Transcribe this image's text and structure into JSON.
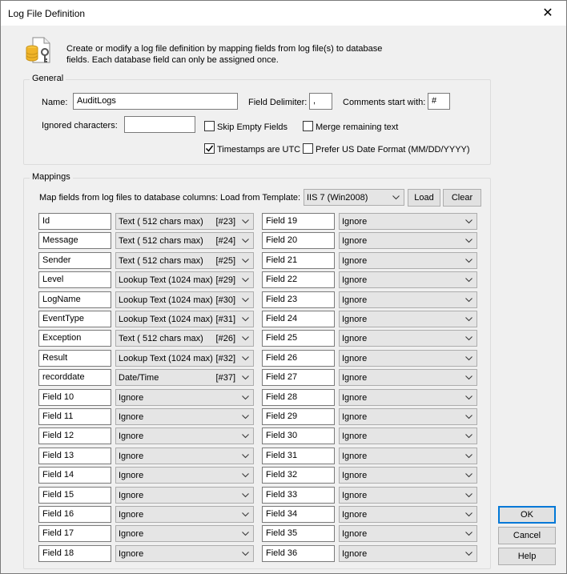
{
  "window": {
    "title": "Log File Definition",
    "close_glyph": "✕"
  },
  "intro": {
    "icon": "database-key-icon",
    "text": "Create or modify a log file definition by mapping fields from log file(s) to database fields. Each database field can only be assigned once."
  },
  "general": {
    "group_label": "General",
    "name_label": "Name:",
    "name_value": "AuditLogs",
    "delimiter_label": "Field Delimiter:",
    "delimiter_value": ",",
    "comments_label": "Comments start with:",
    "comments_value": "#",
    "ignored_label": "Ignored characters:",
    "ignored_value": "",
    "skip_empty": {
      "label": "Skip Empty Fields",
      "checked": false
    },
    "merge_remaining": {
      "label": "Merge remaining text",
      "checked": false
    },
    "timestamps_utc": {
      "label": "Timestamps are UTC",
      "checked": true
    },
    "us_date": {
      "label": "Prefer US Date Format (MM/DD/YYYY)",
      "checked": false
    }
  },
  "mappings": {
    "group_label": "Mappings",
    "map_label": "Map fields from log files to database columns:",
    "template_label": "Load from Template:",
    "template_value": "IIS 7 (Win2008)",
    "load_button": "Load",
    "clear_button": "Clear",
    "left": [
      {
        "field": "Id",
        "type": "Text (  512 chars max)",
        "tag": "[#23]"
      },
      {
        "field": "Message",
        "type": "Text (  512 chars max)",
        "tag": "[#24]"
      },
      {
        "field": "Sender",
        "type": "Text (  512 chars max)",
        "tag": "[#25]"
      },
      {
        "field": "Level",
        "type": "Lookup Text (1024 max)",
        "tag": "[#29]"
      },
      {
        "field": "LogName",
        "type": "Lookup Text (1024 max)",
        "tag": "[#30]"
      },
      {
        "field": "EventType",
        "type": "Lookup Text (1024 max)",
        "tag": "[#31]"
      },
      {
        "field": "Exception",
        "type": "Text (  512 chars max)",
        "tag": "[#26]"
      },
      {
        "field": "Result",
        "type": "Lookup Text (1024 max)",
        "tag": "[#32]"
      },
      {
        "field": "recorddate",
        "type": "Date/Time",
        "tag": "[#37]"
      },
      {
        "field": "Field 10",
        "type": "Ignore",
        "tag": ""
      },
      {
        "field": "Field 11",
        "type": "Ignore",
        "tag": ""
      },
      {
        "field": "Field 12",
        "type": "Ignore",
        "tag": ""
      },
      {
        "field": "Field 13",
        "type": "Ignore",
        "tag": ""
      },
      {
        "field": "Field 14",
        "type": "Ignore",
        "tag": ""
      },
      {
        "field": "Field 15",
        "type": "Ignore",
        "tag": ""
      },
      {
        "field": "Field 16",
        "type": "Ignore",
        "tag": ""
      },
      {
        "field": "Field 17",
        "type": "Ignore",
        "tag": ""
      },
      {
        "field": "Field 18",
        "type": "Ignore",
        "tag": ""
      }
    ],
    "right": [
      {
        "field": "Field 19",
        "type": "Ignore"
      },
      {
        "field": "Field 20",
        "type": "Ignore"
      },
      {
        "field": "Field 21",
        "type": "Ignore"
      },
      {
        "field": "Field 22",
        "type": "Ignore"
      },
      {
        "field": "Field 23",
        "type": "Ignore"
      },
      {
        "field": "Field 24",
        "type": "Ignore"
      },
      {
        "field": "Field 25",
        "type": "Ignore"
      },
      {
        "field": "Field 26",
        "type": "Ignore"
      },
      {
        "field": "Field 27",
        "type": "Ignore"
      },
      {
        "field": "Field 28",
        "type": "Ignore"
      },
      {
        "field": "Field 29",
        "type": "Ignore"
      },
      {
        "field": "Field 30",
        "type": "Ignore"
      },
      {
        "field": "Field 31",
        "type": "Ignore"
      },
      {
        "field": "Field 32",
        "type": "Ignore"
      },
      {
        "field": "Field 33",
        "type": "Ignore"
      },
      {
        "field": "Field 34",
        "type": "Ignore"
      },
      {
        "field": "Field 35",
        "type": "Ignore"
      },
      {
        "field": "Field 36",
        "type": "Ignore"
      }
    ]
  },
  "buttons": {
    "ok": "OK",
    "cancel": "Cancel",
    "help": "Help"
  },
  "colors": {
    "accent": "#0078d7",
    "combo_bg": "#e5e5e5",
    "window_bg": "#f0f0f0"
  }
}
